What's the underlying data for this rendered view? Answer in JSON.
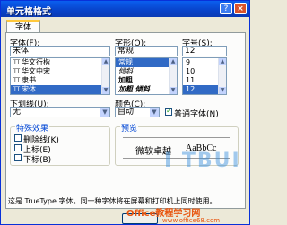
{
  "window": {
    "title": "单元格格式",
    "help_glyph": "?",
    "close_glyph": "×"
  },
  "tabs": [
    {
      "label": "字体"
    }
  ],
  "font": {
    "label": "字体(F):",
    "value": "宋体",
    "list": [
      "华文行楷",
      "华文中宋",
      "隶书",
      "宋体"
    ],
    "selected_index": 3
  },
  "style": {
    "label": "字形(O):",
    "value": "常规",
    "list": [
      "常规",
      "倾斜",
      "加粗",
      "加粗 倾斜"
    ],
    "selected_index": 0
  },
  "size": {
    "label": "字号(S):",
    "value": "12",
    "list": [
      "9",
      "10",
      "11",
      "12"
    ],
    "selected_index": 3
  },
  "underline": {
    "label": "下划线(U):",
    "value": "无"
  },
  "color": {
    "label": "颜色(C):",
    "value": "自动"
  },
  "normal_font": {
    "label": "普通字体(N)",
    "checked": true
  },
  "effects": {
    "title": "特殊效果",
    "items": [
      {
        "label": "删除线(K)",
        "checked": false
      },
      {
        "label": "上标(E)",
        "checked": false
      },
      {
        "label": "下标(B)",
        "checked": false
      }
    ]
  },
  "preview": {
    "title": "预览",
    "sample_cjk": "微软卓越",
    "sample_latin": "AaBbCc"
  },
  "description": "这是 TrueType 字体。同一种字体将在屏幕和打印机上同时使用。",
  "watermark": {
    "logo": "I TBUI",
    "text": "Office教程学习网",
    "url": "www.office68.com"
  }
}
